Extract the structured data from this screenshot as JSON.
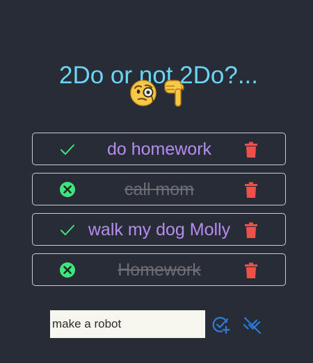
{
  "header": {
    "title": "2Do or not 2Do?...",
    "emojis": [
      "face-with-monocle-icon",
      "backhand-index-pointing-down-icon"
    ]
  },
  "todos": [
    {
      "text": "do homework",
      "completed": false,
      "status_icon": "check-icon",
      "delete_icon": "trash-icon"
    },
    {
      "text": "call mom",
      "completed": true,
      "status_icon": "circle-x-icon",
      "delete_icon": "trash-icon"
    },
    {
      "text": "walk my dog Molly",
      "completed": false,
      "status_icon": "check-icon",
      "delete_icon": "trash-icon"
    },
    {
      "text": "Homework",
      "completed": true,
      "status_icon": "circle-x-icon",
      "delete_icon": "trash-icon"
    }
  ],
  "new_task": {
    "value": "make a robot",
    "add_icon": "add-task-icon",
    "clear_icon": "remove-done-icon"
  },
  "colors": {
    "background": "#282c37",
    "title": "#6ad5f5",
    "task_text": "#b68cf0",
    "done_text": "#6c6e73",
    "check": "#3fe57d",
    "delete": "#f0504a",
    "action_blue": "#2b7de0"
  }
}
